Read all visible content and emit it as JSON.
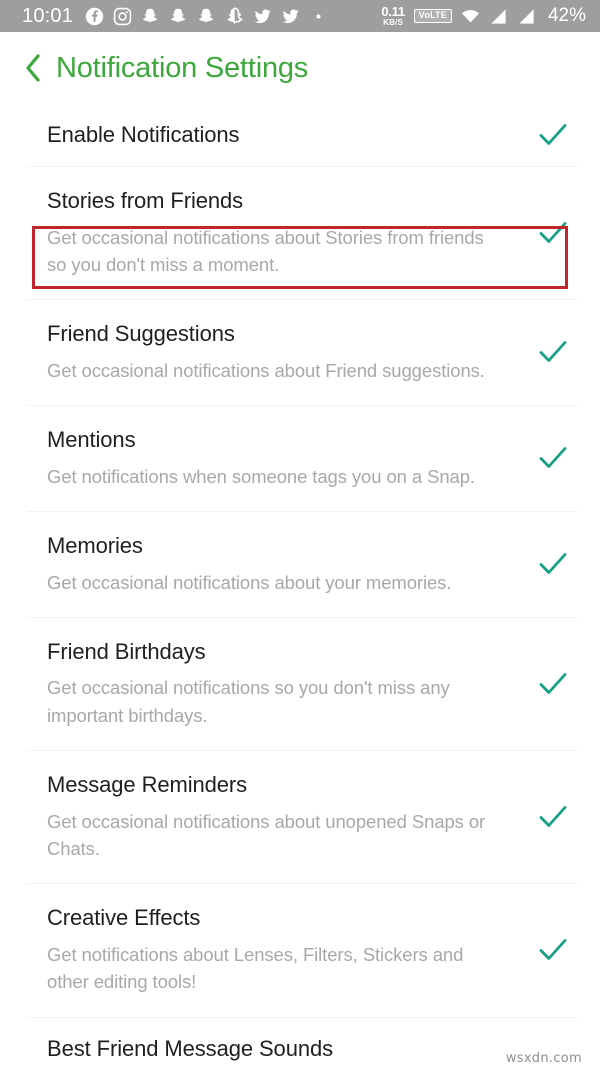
{
  "status_bar": {
    "clock": "10:01",
    "left_icons": [
      {
        "name": "facebook-icon"
      },
      {
        "name": "instagram-icon"
      },
      {
        "name": "snapchat-icon"
      },
      {
        "name": "snapchat-icon"
      },
      {
        "name": "snapchat-icon"
      },
      {
        "name": "snapchat-ghost-icon"
      },
      {
        "name": "twitter-icon"
      },
      {
        "name": "twitter-icon"
      },
      {
        "name": "more-dot-icon"
      }
    ],
    "network_speed_value": "0.11",
    "network_speed_unit": "KB/S",
    "volte_label": "VoLTE",
    "battery": "42%"
  },
  "header": {
    "back_label": "‹",
    "title": "Notification Settings",
    "title_color": "#3ca83c"
  },
  "highlight": {
    "color": "#c0272d"
  },
  "check_color": "#16a085",
  "settings": [
    {
      "title": "Enable Notifications",
      "desc": "",
      "checked": true,
      "highlighted": true
    },
    {
      "title": "Stories from Friends",
      "desc": "Get occasional notifications about Stories from friends so you don't miss a moment.",
      "checked": true,
      "highlighted": false
    },
    {
      "title": "Friend Suggestions",
      "desc": "Get occasional notifications about Friend suggestions.",
      "checked": true,
      "highlighted": false
    },
    {
      "title": "Mentions",
      "desc": "Get notifications when someone tags you on a Snap.",
      "checked": true,
      "highlighted": false
    },
    {
      "title": "Memories",
      "desc": "Get occasional notifications about your memories.",
      "checked": true,
      "highlighted": false
    },
    {
      "title": "Friend Birthdays",
      "desc": "Get occasional notifications so you don't miss any important birthdays.",
      "checked": true,
      "highlighted": false
    },
    {
      "title": "Message Reminders",
      "desc": "Get occasional notifications about unopened Snaps or Chats.",
      "checked": true,
      "highlighted": false
    },
    {
      "title": "Creative Effects",
      "desc": "Get notifications about Lenses, Filters, Stickers and other editing tools!",
      "checked": true,
      "highlighted": false
    },
    {
      "title": "Best Friend Message Sounds",
      "desc": "",
      "checked": false,
      "highlighted": false
    }
  ],
  "watermark": "wsxdn.com"
}
